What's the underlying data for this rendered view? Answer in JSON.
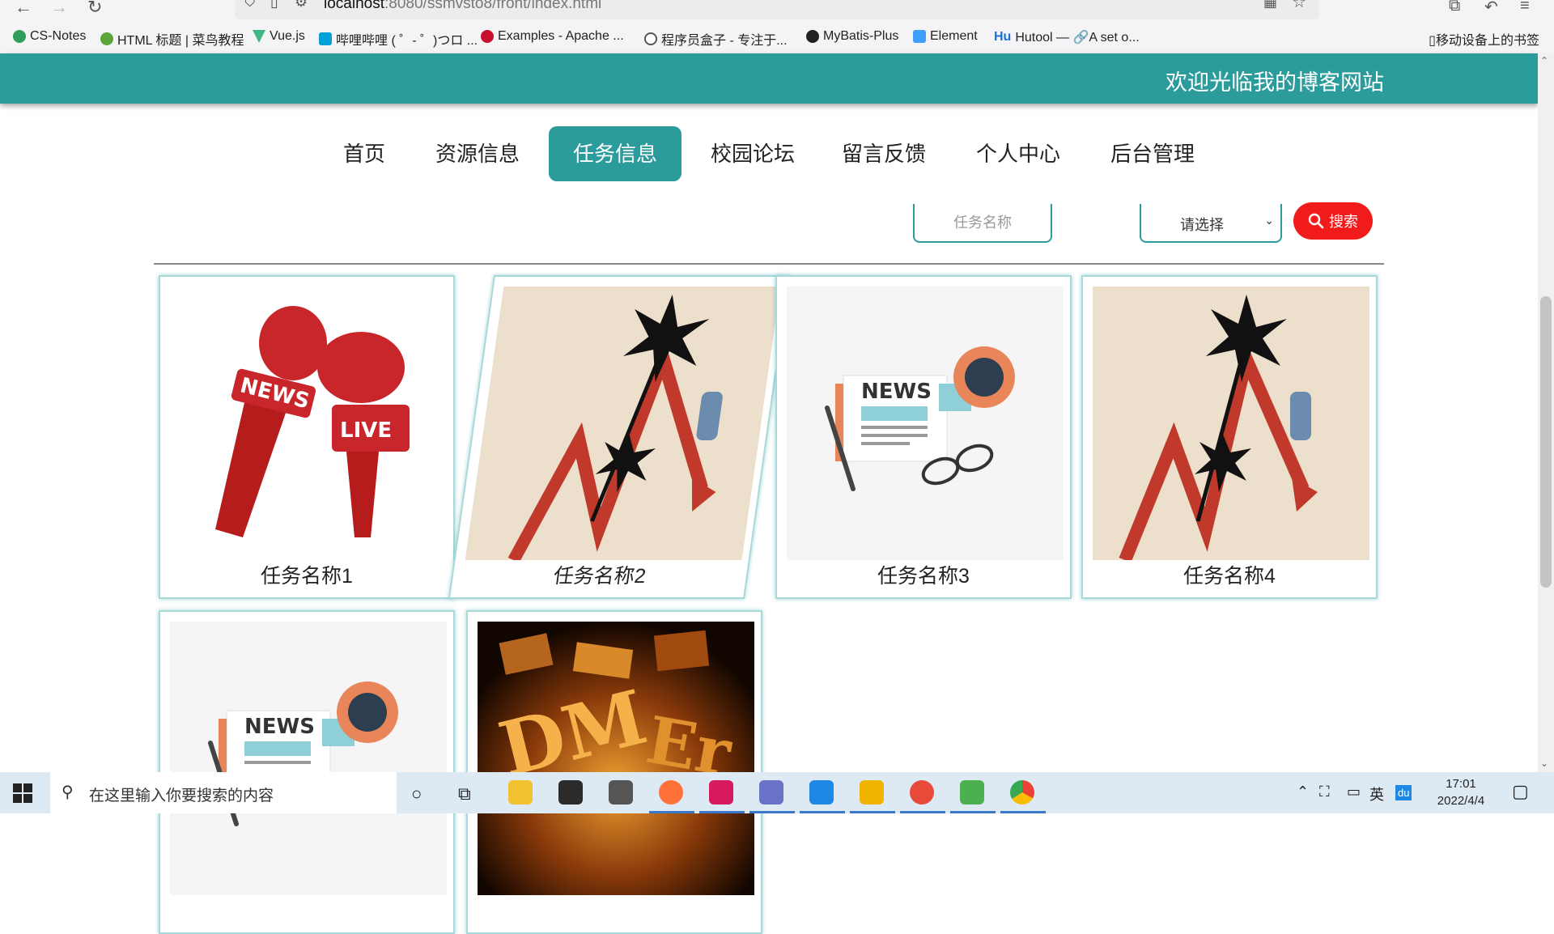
{
  "browser": {
    "url_host": "localhost",
    "url_rest": ":8080/ssmvsto8/front/index.html"
  },
  "bookmarks": [
    {
      "label": "CS-Notes",
      "color": "#2e9e5a"
    },
    {
      "label": "HTML 标题 | 菜鸟教程",
      "color": "#5aa63a"
    },
    {
      "label": "Vue.js",
      "color": "#41b883"
    },
    {
      "label": "哔哩哔哩 ( ゜- ゜)つロ ...",
      "color": "#00a1d6"
    },
    {
      "label": "Examples - Apache ...",
      "color": "#c8102e"
    },
    {
      "label": "程序员盒子 - 专注于...",
      "color": "#555555"
    },
    {
      "label": "MyBatis-Plus",
      "color": "#222222"
    },
    {
      "label": "Element",
      "color": "#409eff"
    },
    {
      "label": "Hutool — 🔗A set o...",
      "color": "#1e6fd0"
    }
  ],
  "mobile_bookmarks": "移动设备上的书签",
  "site": {
    "title": "欢迎光临我的博客网站",
    "accent": "#2b9b9b"
  },
  "nav": {
    "items": [
      "首页",
      "资源信息",
      "任务信息",
      "校园论坛",
      "留言反馈",
      "个人中心",
      "后台管理"
    ],
    "active_index": 2
  },
  "search": {
    "placeholder": "任务名称",
    "select_value": "请选择",
    "button_label": "搜索",
    "button_color": "#f21b1b"
  },
  "cards": [
    {
      "title": "任务名称1",
      "image": "news-microphones"
    },
    {
      "title": "任务名称2",
      "image": "crash-chart"
    },
    {
      "title": "任务名称3",
      "image": "newspaper-coffee"
    },
    {
      "title": "任务名称4",
      "image": "crash-chart"
    },
    {
      "title": "",
      "image": "newspaper-coffee"
    },
    {
      "title": "",
      "image": "gold-letters"
    }
  ],
  "taskbar": {
    "search_placeholder": "在这里输入你要搜索的内容",
    "time": "17:01",
    "date": "2022/4/4",
    "ime": "英"
  }
}
